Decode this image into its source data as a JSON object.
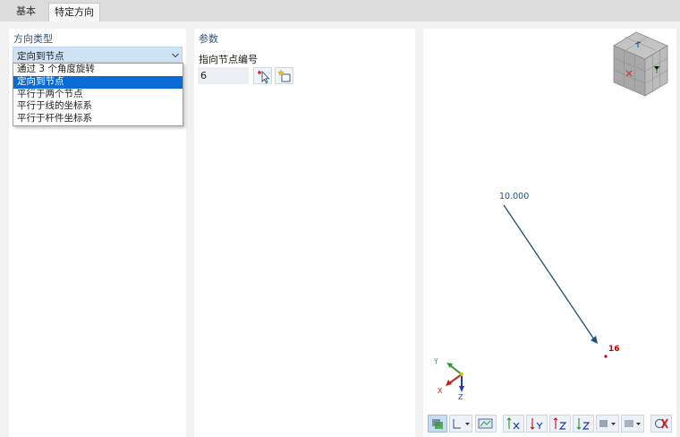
{
  "tabs": [
    {
      "label": "基本"
    },
    {
      "label": "特定方向"
    }
  ],
  "direction_type": {
    "title": "方向类型",
    "selected": "定向到节点",
    "options": [
      "通过 3 个角度旋转",
      "定向到节点",
      "平行于两个节点",
      "平行于线的坐标系",
      "平行于杆件坐标系"
    ]
  },
  "parameters": {
    "title": "参数",
    "node_label": "指向节点编号",
    "node_value": "6"
  },
  "view": {
    "vector_label": "10.000",
    "node_number": "16",
    "axes": {
      "x": "X",
      "y": "Y",
      "z": "Z"
    },
    "toolbar_buttons": [
      "display-options-icon",
      "axis-dropdown-icon",
      "view-settings-icon",
      "view-x-icon",
      "view-neg-y-icon",
      "view-z-icon",
      "view-neg-z-icon",
      "color-dropdown-icon",
      "render-dropdown-icon",
      "reset-icon"
    ]
  },
  "colors": {
    "accent": "#0a6ad6",
    "vector": "#1f4e7a",
    "node": "#c00000",
    "title": "#36536f"
  }
}
